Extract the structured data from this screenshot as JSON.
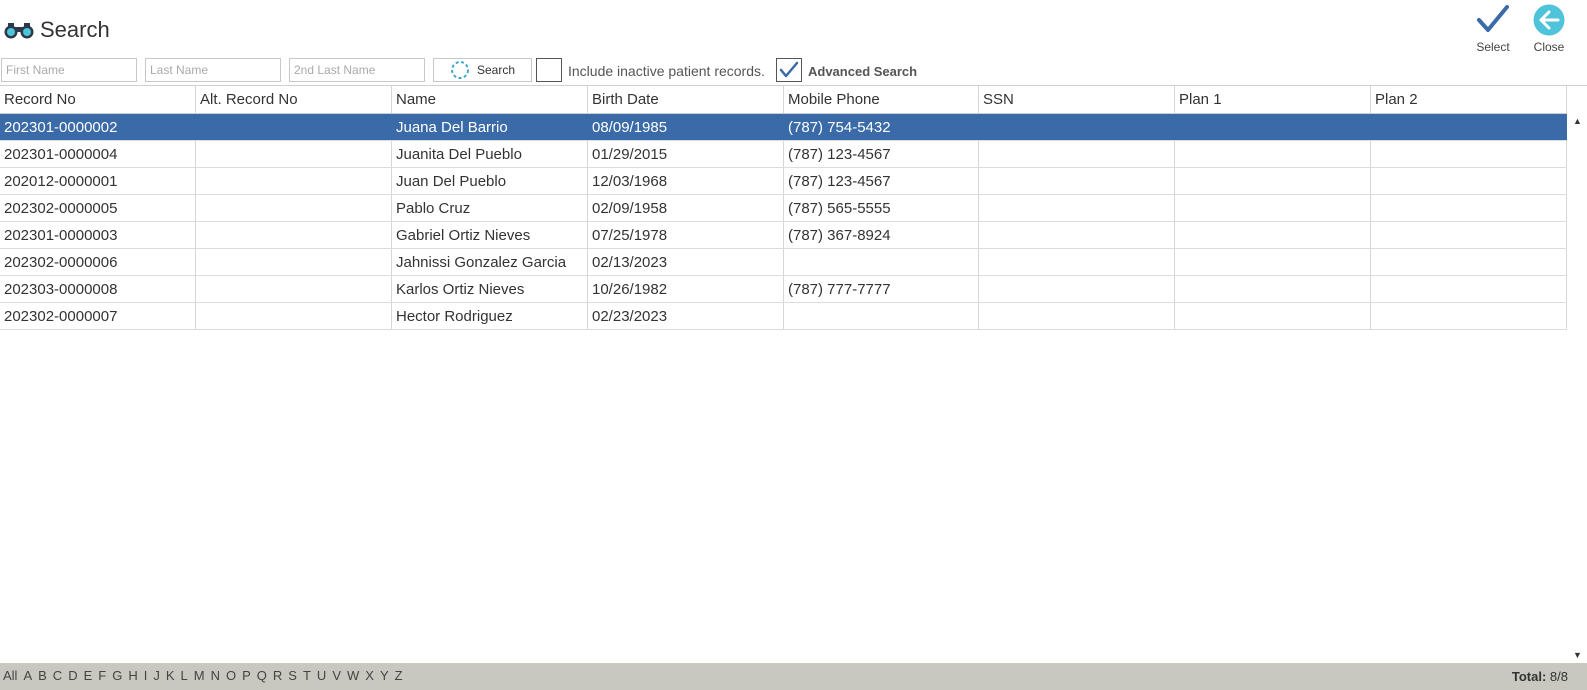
{
  "header": {
    "title": "Search",
    "select_label": "Select",
    "close_label": "Close"
  },
  "toolbar": {
    "first_name_placeholder": "First Name",
    "last_name_placeholder": "Last Name",
    "last_name2_placeholder": "2nd Last Name",
    "first_name_value": "",
    "last_name_value": "",
    "last_name2_value": "",
    "search_label": "Search",
    "include_inactive_label": "Include inactive patient records.",
    "include_inactive_checked": false,
    "advanced_search_label": "Advanced Search",
    "advanced_search_checked": true
  },
  "table": {
    "columns": [
      "Record No",
      "Alt. Record No",
      "Name",
      "Birth Date",
      "Mobile Phone",
      "SSN",
      "Plan 1",
      "Plan 2"
    ],
    "rows": [
      {
        "record_no": "202301-0000002",
        "alt_record_no": "",
        "name": "Juana Del Barrio",
        "birth_date": "08/09/1985",
        "mobile_phone": "(787) 754-5432",
        "ssn": "",
        "plan1": "",
        "plan2": "",
        "selected": true
      },
      {
        "record_no": "202301-0000004",
        "alt_record_no": "",
        "name": "Juanita Del Pueblo",
        "birth_date": "01/29/2015",
        "mobile_phone": "(787) 123-4567",
        "ssn": "",
        "plan1": "",
        "plan2": "",
        "selected": false
      },
      {
        "record_no": "202012-0000001",
        "alt_record_no": "",
        "name": "Juan Del Pueblo",
        "birth_date": "12/03/1968",
        "mobile_phone": "(787) 123-4567",
        "ssn": "",
        "plan1": "",
        "plan2": "",
        "selected": false
      },
      {
        "record_no": "202302-0000005",
        "alt_record_no": "",
        "name": "Pablo Cruz",
        "birth_date": "02/09/1958",
        "mobile_phone": "(787) 565-5555",
        "ssn": "",
        "plan1": "",
        "plan2": "",
        "selected": false
      },
      {
        "record_no": "202301-0000003",
        "alt_record_no": "",
        "name": "Gabriel Ortiz Nieves",
        "birth_date": "07/25/1978",
        "mobile_phone": "(787) 367-8924",
        "ssn": "",
        "plan1": "",
        "plan2": "",
        "selected": false
      },
      {
        "record_no": "202302-0000006",
        "alt_record_no": "",
        "name": "Jahnissi Gonzalez Garcia",
        "birth_date": "02/13/2023",
        "mobile_phone": "",
        "ssn": "",
        "plan1": "",
        "plan2": "",
        "selected": false
      },
      {
        "record_no": "202303-0000008",
        "alt_record_no": "",
        "name": "Karlos Ortiz Nieves",
        "birth_date": "10/26/1982",
        "mobile_phone": "(787) 777-7777",
        "ssn": "",
        "plan1": "",
        "plan2": "",
        "selected": false
      },
      {
        "record_no": "202302-0000007",
        "alt_record_no": "",
        "name": "Hector Rodriguez",
        "birth_date": "02/23/2023",
        "mobile_phone": "",
        "ssn": "",
        "plan1": "",
        "plan2": "",
        "selected": false
      }
    ]
  },
  "footer": {
    "alphabet": [
      "All",
      "A",
      "B",
      "C",
      "D",
      "E",
      "F",
      "G",
      "H",
      "I",
      "J",
      "K",
      "L",
      "M",
      "N",
      "O",
      "P",
      "Q",
      "R",
      "S",
      "T",
      "U",
      "V",
      "W",
      "X",
      "Y",
      "Z"
    ],
    "total_label": "Total:",
    "total_value": "8/8"
  },
  "icons": {
    "title_icon": "binoculars-icon",
    "select_icon": "checkmark-icon",
    "close_icon": "arrow-left-circle-icon",
    "search_icon": "refresh-spinner-icon"
  },
  "colors": {
    "selected_row": "#3a6aa8",
    "accent_check": "#3a6aa8",
    "close_circle": "#4fc3d9",
    "footer_bg": "#c8c8c0"
  }
}
